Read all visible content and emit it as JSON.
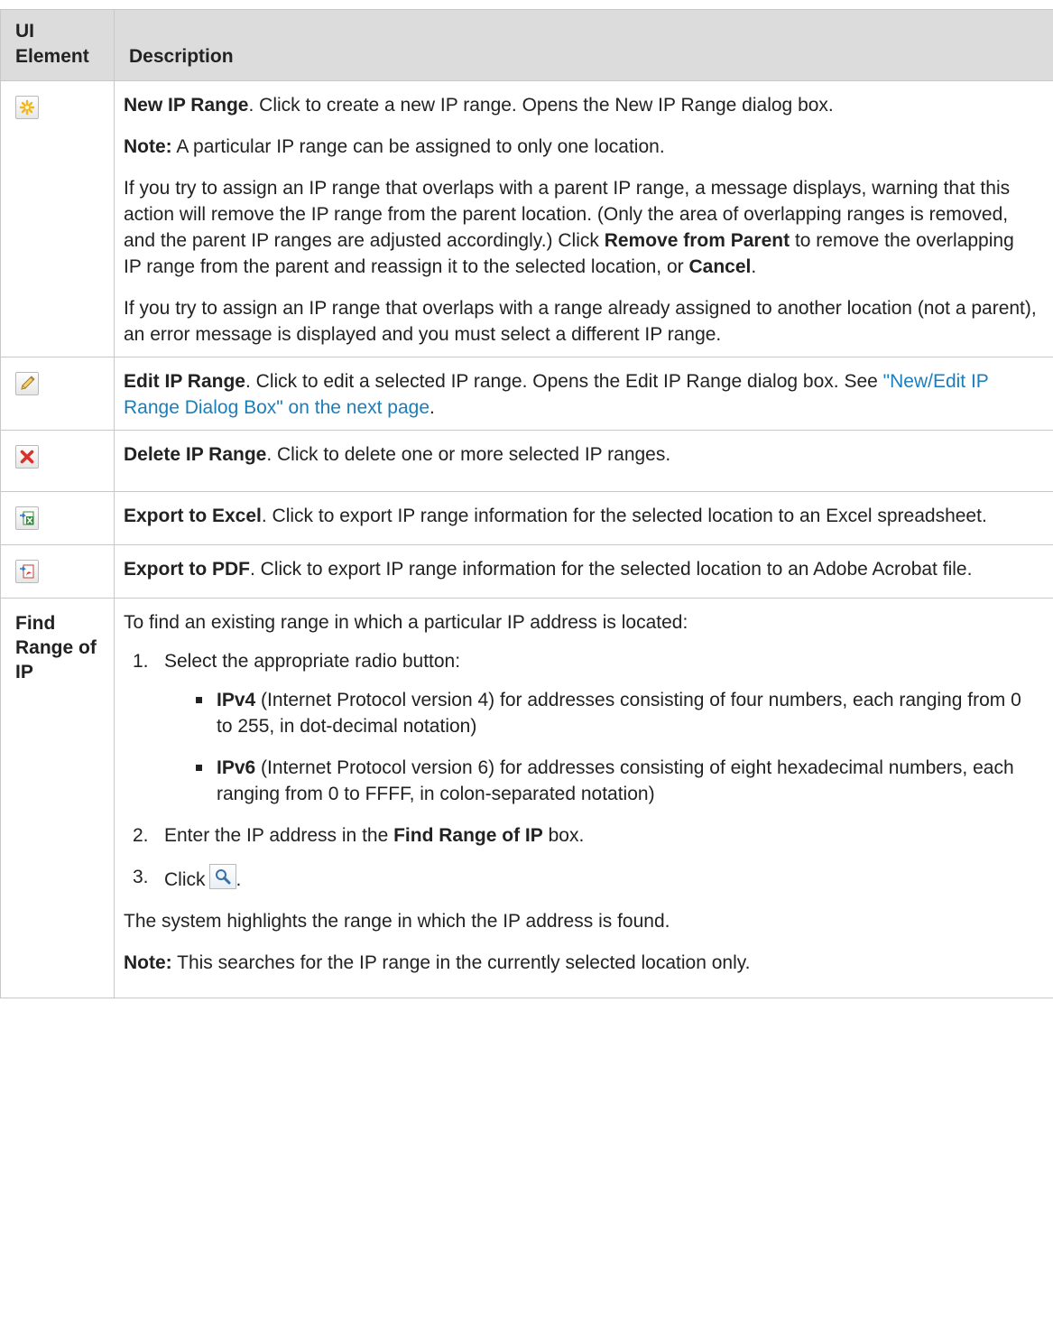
{
  "header": {
    "col1": "UI Element",
    "col2": "Description"
  },
  "rows": {
    "new": {
      "icon": "new-star-icon",
      "title": "New IP Range",
      "text": ". Click to create a new IP range. Opens the New IP Range dialog box.",
      "note_label": "Note:",
      "note_text": " A particular IP range can be assigned to only one location.",
      "p3_a": "If you try to assign an IP range that overlaps with a parent IP range, a message displays, warning that this action will remove the IP range from the parent location. (Only the area of overlapping ranges is removed, and the parent IP ranges are adjusted accordingly.) Click ",
      "p3_b": "Remove from Parent",
      "p3_c": " to remove the overlapping IP range from the parent and reassign it to the selected location, or ",
      "p3_d": "Cancel",
      "p3_e": ".",
      "p4": "If you try to assign an IP range that overlaps with a range already assigned to another location (not a parent), an error message is displayed and you must select a different IP range."
    },
    "edit": {
      "icon": "pencil-icon",
      "title": "Edit IP Range",
      "text": ". Click to edit a selected IP range. Opens the Edit IP Range dialog box. See ",
      "link": "\"New/Edit IP Range Dialog Box\" on the next page",
      "tail": "."
    },
    "delete": {
      "icon": "red-x-icon",
      "title": "Delete IP Range",
      "text": ". Click to delete one or more selected IP ranges."
    },
    "excel": {
      "icon": "export-excel-icon",
      "title": "Export to Excel",
      "text": ". Click to export IP range information for the selected location to an Excel spreadsheet."
    },
    "pdf": {
      "icon": "export-pdf-icon",
      "title": "Export to PDF",
      "text": ". Click to export IP range information for the selected location to an Adobe Acrobat file."
    },
    "find": {
      "label": "Find Range of IP",
      "intro": "To find an existing range in which a particular IP address is located:",
      "step1_num": "1.",
      "step1": "Select the appropriate radio button:",
      "ipv4_b": "IPv4",
      "ipv4_t": " (Internet Protocol version 4) for addresses consisting of four numbers, each ranging from 0 to 255, in dot-decimal notation)",
      "ipv6_b": "IPv6",
      "ipv6_t": " (Internet Protocol version 6) for addresses consisting of eight hexadecimal numbers, each ranging from 0 to FFFF, in colon-separated notation)",
      "step2_num": "2.",
      "step2_a": "Enter the IP address in the ",
      "step2_b": "Find Range of IP",
      "step2_c": " box.",
      "step3_num": "3.",
      "step3_a": "Click",
      "step3_icon": "magnifier-search-icon",
      "step3_c": ".",
      "result": "The system highlights the range in which the IP address is found.",
      "note_label": "Note:",
      "note_text": " This searches for the IP range in the currently selected location only."
    }
  }
}
